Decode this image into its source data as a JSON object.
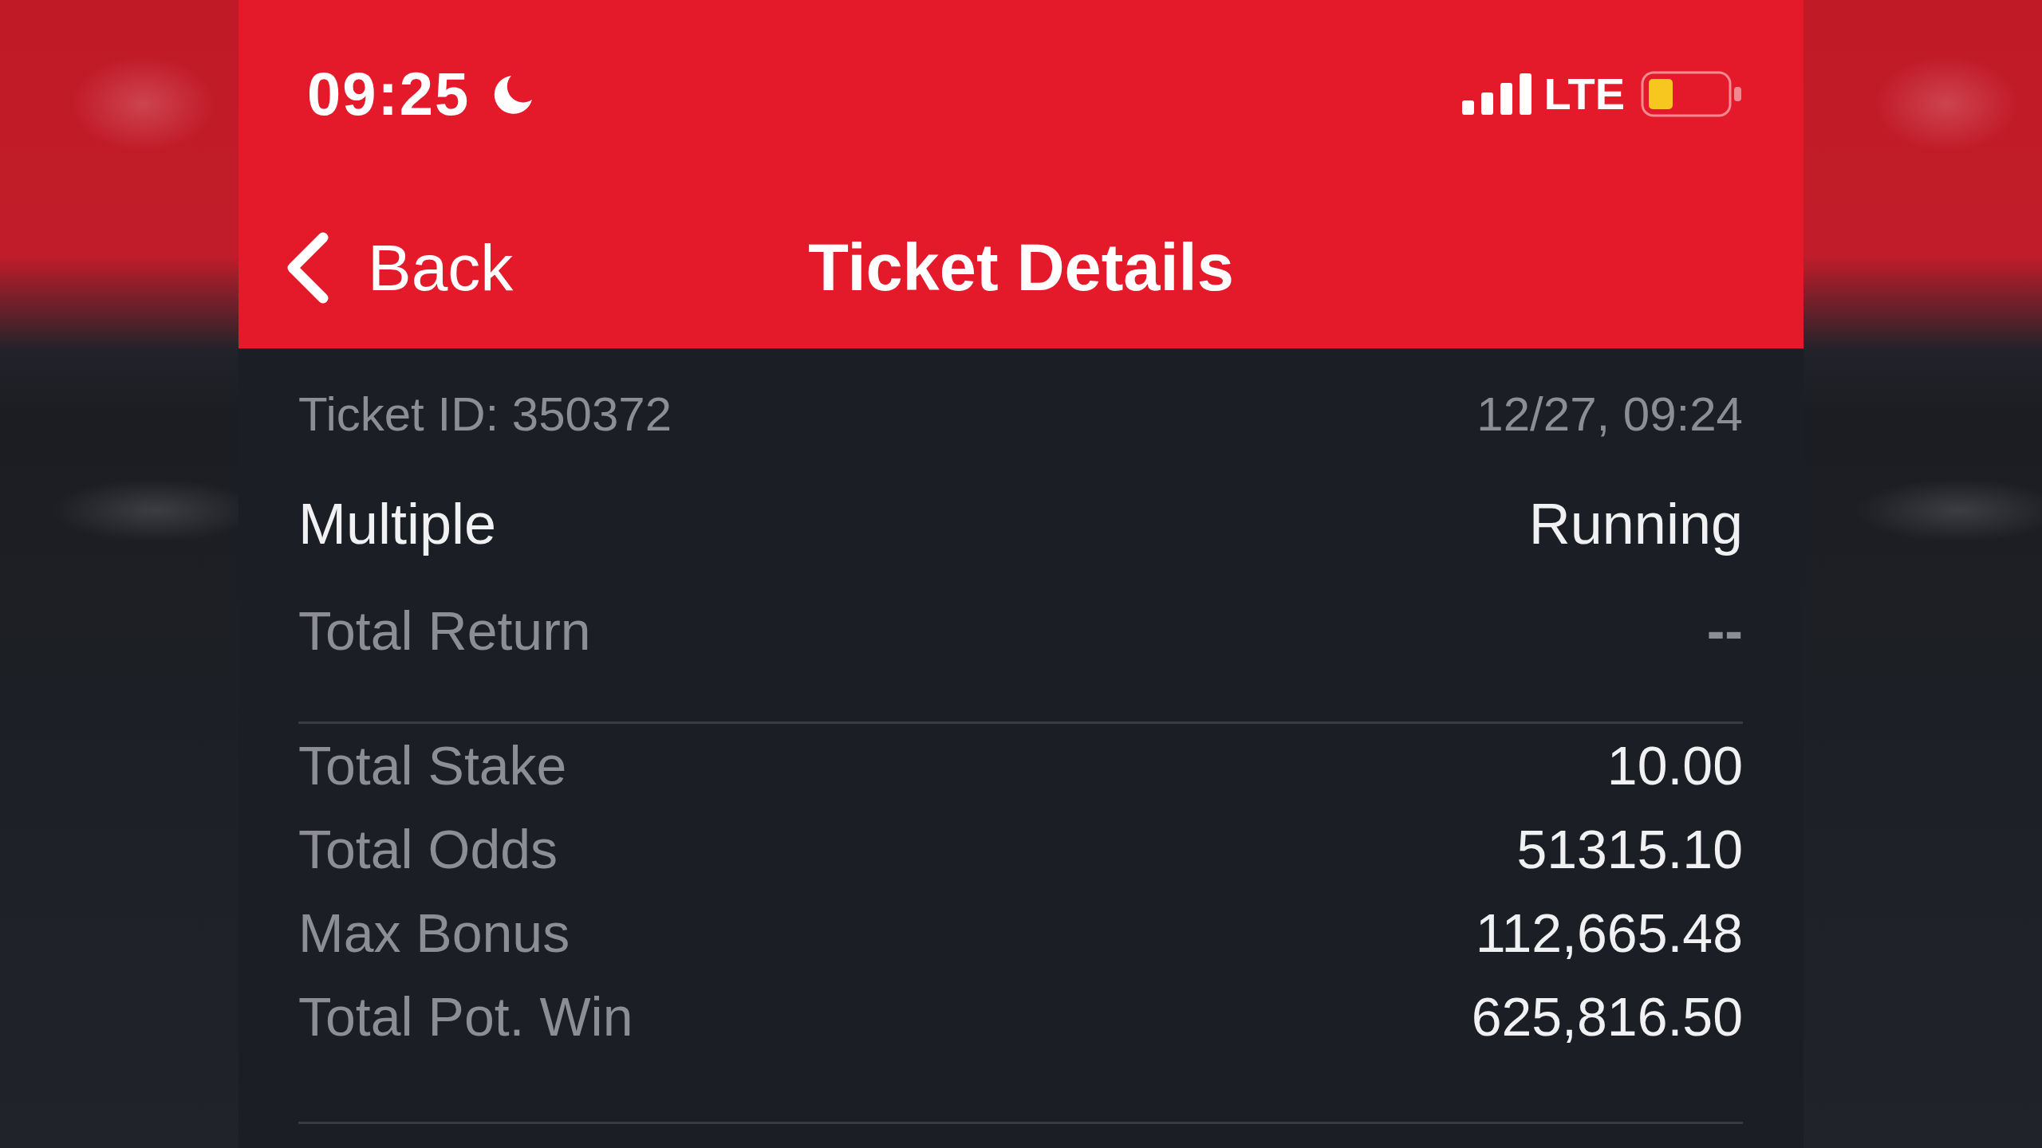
{
  "status_bar": {
    "time": "09:25",
    "network": "LTE"
  },
  "nav_bar": {
    "back": "Back",
    "title": "Ticket Details"
  },
  "ticket": {
    "id_text": "Ticket ID: 350372",
    "datetime": "12/27, 09:24",
    "type": "Multiple",
    "status": "Running",
    "total_return": {
      "label": "Total Return",
      "value": "--"
    }
  },
  "summary": [
    {
      "label": "Total Stake",
      "value": "10.00"
    },
    {
      "label": "Total Odds",
      "value": "51315.10"
    },
    {
      "label": "Max Bonus",
      "value": "112,665.48"
    },
    {
      "label": "Total Pot. Win",
      "value": "625,816.50"
    }
  ]
}
